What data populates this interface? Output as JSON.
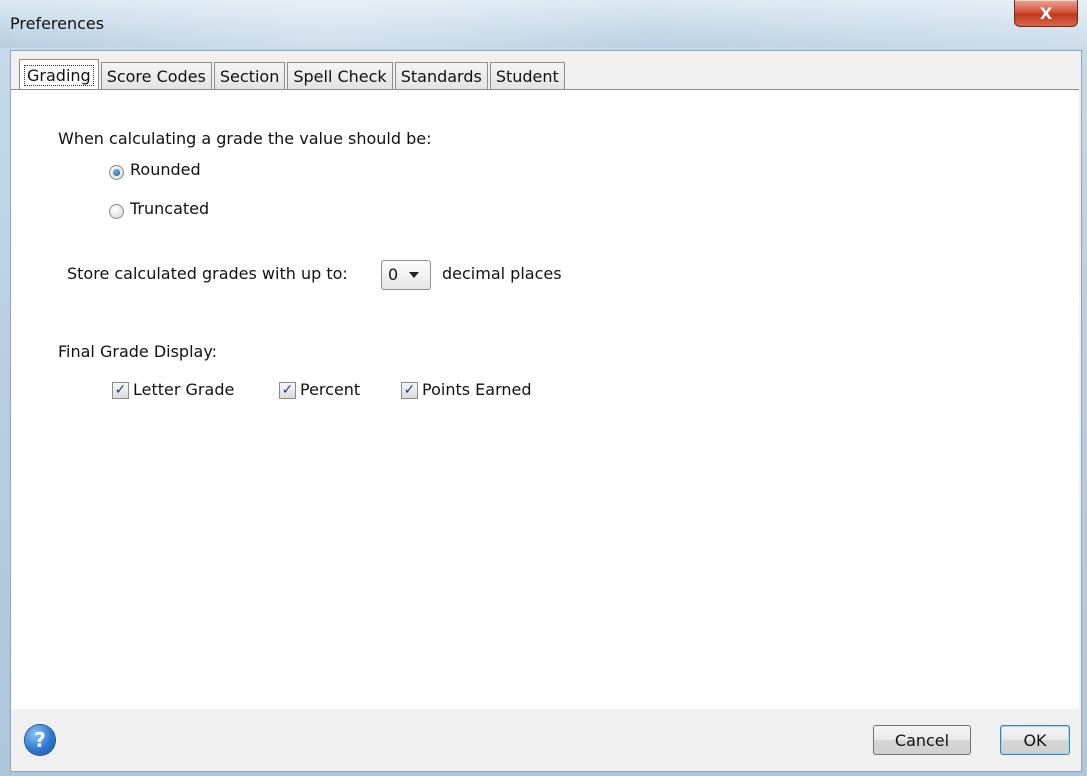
{
  "window": {
    "title": "Preferences",
    "close_glyph": "X"
  },
  "tabs": [
    {
      "label": "Grading",
      "active": true
    },
    {
      "label": "Score Codes"
    },
    {
      "label": "Section"
    },
    {
      "label": "Spell Check"
    },
    {
      "label": "Standards"
    },
    {
      "label": "Student"
    }
  ],
  "grading": {
    "calc_heading": "When calculating a grade the value should be:",
    "rounding_options": [
      {
        "label": "Rounded",
        "selected": true
      },
      {
        "label": "Truncated",
        "selected": false
      }
    ],
    "store_prefix": "Store calculated grades with up to:",
    "decimal_places_value": "0",
    "store_suffix": "decimal places",
    "final_display_heading": "Final Grade Display:",
    "display_options": [
      {
        "label": "Letter Grade",
        "checked": true
      },
      {
        "label": "Percent",
        "checked": true
      },
      {
        "label": "Points Earned",
        "checked": true
      }
    ]
  },
  "footer": {
    "help_glyph": "?",
    "cancel_label": "Cancel",
    "ok_label": "OK"
  },
  "colors": {
    "accent": "#2d78d1",
    "close": "#c3381f",
    "default_button_border": "#3c7fb1"
  }
}
